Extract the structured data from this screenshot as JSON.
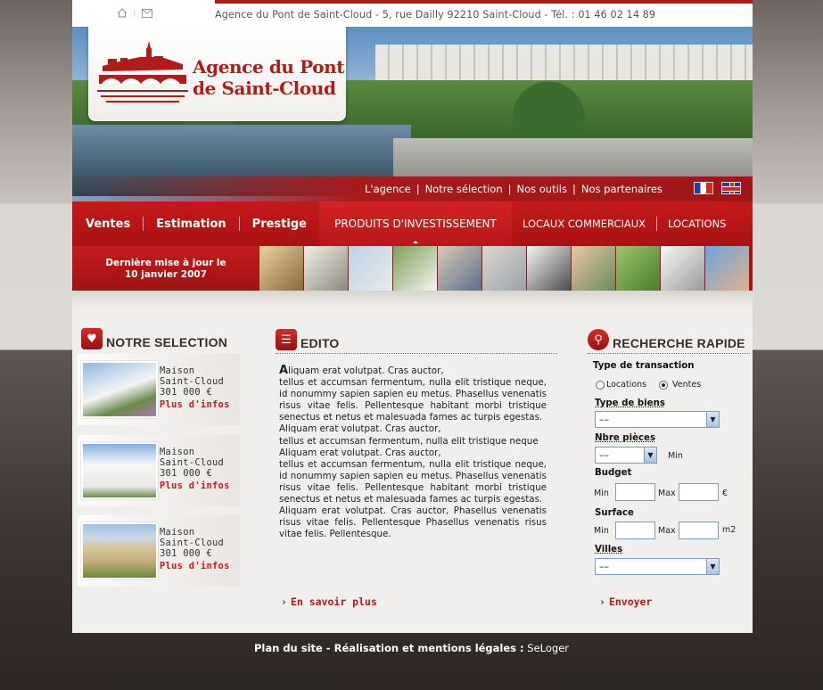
{
  "topbar": {
    "home_icon": "home-icon",
    "mail_icon": "mail-icon",
    "address": "Agence du Pont de Saint-Cloud - 5, rue Dailly 92210 Saint-Cloud - Tél. : 01 46 02 14 89"
  },
  "logo": {
    "line1": "Agence du Pont",
    "line2": "de Saint-Cloud"
  },
  "subnav": [
    "L'agence",
    "Notre sélection",
    "Nos outils",
    "Nos partenaires"
  ],
  "mainnav": [
    "Ventes",
    "Estimation",
    "Prestige",
    "Produits d'investissement",
    "Locaux commerciaux",
    "Locations"
  ],
  "update": {
    "line1": "Dernière mise à jour le",
    "line2": "10 janvier 2007"
  },
  "selection": {
    "title": "NOTRE SELECTION",
    "items": [
      {
        "type": "Maison",
        "city": "Saint-Cloud",
        "price": "301 000 €",
        "more": "Plus d'infos"
      },
      {
        "type": "Maison",
        "city": "Saint-Cloud",
        "price": "301 000 €",
        "more": "Plus d'infos"
      },
      {
        "type": "Maison",
        "city": "Saint-Cloud",
        "price": "301 000 €",
        "more": "Plus d'infos"
      }
    ]
  },
  "edito": {
    "title": "EDITO",
    "drop": "A",
    "p1": "liquam erat volutpat. Cras auctor,",
    "p2": "tellus et accumsan fermentum, nulla elit tristique neque, id nonummy sapien sapien eu metus. Phasellus venenatis risus vitae felis. Pellentesque habitant morbi tristique senectus et netus et malesuada fames ac turpis egestas.",
    "p3": "Aliquam erat volutpat. Cras auctor,",
    "p4": "tellus et accumsan fermentum, nulla elit tristique neque",
    "p5": "Aliquam erat volutpat. Cras auctor,",
    "p6": "tellus et accumsan fermentum, nulla elit tristique neque, id nonummy sapien sapien eu metus. Phasellus venenatis risus vitae felis. Pellentesque habitant morbi tristique senectus et netus et malesuada fames ac turpis egestas.",
    "p7": "Aliquam erat volutpat. Cras auctor, Phasellus venenatis risus vitae felis. Pellentesque Phasellus venenatis risus vitae felis. Pellentesque.",
    "more": "En savoir plus"
  },
  "search": {
    "title": "RECHERCHE RAPIDE",
    "transaction_label": "Type de transaction",
    "opt_locations": "Locations",
    "opt_ventes": "Ventes",
    "type_label": "Type de biens",
    "type_value": "––",
    "pieces_label": "Nbre pièces",
    "pieces_value": "––",
    "pieces_min": "Min",
    "budget_label": "Budget",
    "surface_label": "Surface",
    "min": "Min",
    "max": "Max",
    "euro": "€",
    "m2": "m2",
    "villes_label": "Villes",
    "villes_value": "––",
    "submit": "Envoyer"
  },
  "footer": {
    "plan": "Plan du site",
    "sep": " - ",
    "credits": "Réalisation et mentions légales :",
    "brand": " SeLoger"
  }
}
